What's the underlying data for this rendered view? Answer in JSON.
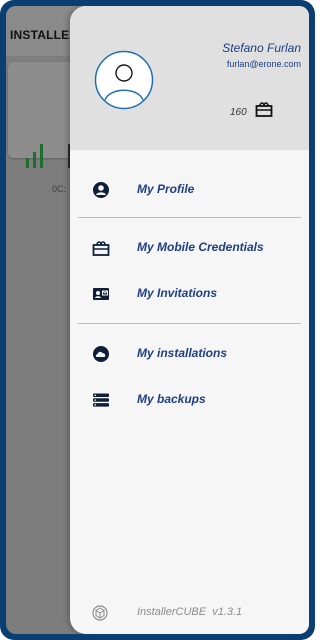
{
  "background_app": {
    "title": "INSTALLEF",
    "device_id_partial": "0C:"
  },
  "drawer": {
    "user": {
      "name": "Stefano Furlan",
      "email": "furlan@erone.com",
      "credits": "160"
    },
    "menu": [
      {
        "label": "My Profile",
        "icon": "account-circle-icon"
      },
      {
        "label": "My Mobile Credentials",
        "icon": "credential-ticket-icon"
      },
      {
        "label": "My Invitations",
        "icon": "invitation-card-icon"
      },
      {
        "label": "My installations",
        "icon": "cloud-icon"
      },
      {
        "label": "My backups",
        "icon": "storage-icon"
      }
    ],
    "footer": {
      "app_version": "InstallerCUBE  v1.3.1",
      "icon": "cube-logo-icon"
    }
  },
  "colors": {
    "accent": "#1e3f86",
    "frame": "#0b3f73",
    "overlay": "#7d7d7d",
    "header_bg": "#e0e0e0"
  }
}
